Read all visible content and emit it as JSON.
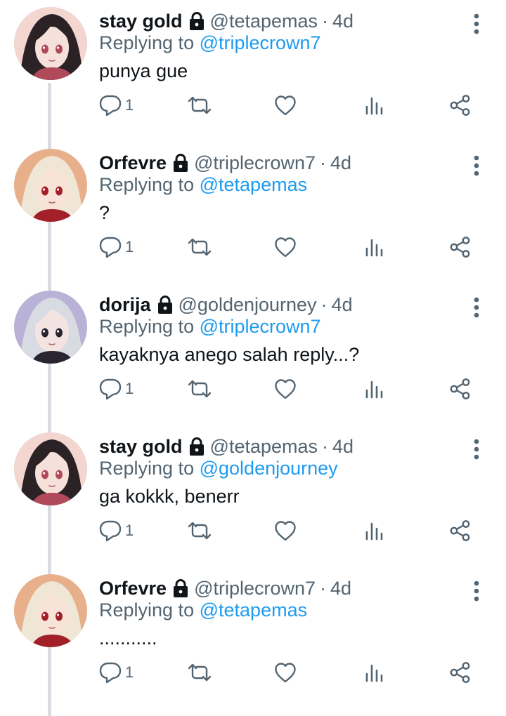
{
  "tweets": [
    {
      "display_name": "stay gold",
      "handle": "@tetapemas",
      "time": "4d",
      "replying_label": "Replying to",
      "replying_to": "@triplecrown7",
      "text": "punya gue",
      "reply_count": "1",
      "avatar_palette": {
        "bg": "#f3d6cf",
        "hair": "#2b2226",
        "skin": "#f6e1da",
        "accent": "#b04a5a"
      }
    },
    {
      "display_name": "Orfevre",
      "handle": "@triplecrown7",
      "time": "4d",
      "replying_label": "Replying to",
      "replying_to": "@tetapemas",
      "text": "?",
      "reply_count": "1",
      "avatar_palette": {
        "bg": "#e7b08a",
        "hair": "#efe6d5",
        "skin": "#f7e3d8",
        "accent": "#a3202a"
      }
    },
    {
      "display_name": "dorija",
      "handle": "@goldenjourney",
      "time": "4d",
      "replying_label": "Replying to",
      "replying_to": "@triplecrown7",
      "text": "kayaknya anego salah reply...?",
      "reply_count": "1",
      "avatar_palette": {
        "bg": "#b9b2d6",
        "hair": "#d9dbe3",
        "skin": "#f4e4e1",
        "accent": "#2a2431"
      }
    },
    {
      "display_name": "stay gold",
      "handle": "@tetapemas",
      "time": "4d",
      "replying_label": "Replying to",
      "replying_to": "@goldenjourney",
      "text": "ga kokkk, benerr",
      "reply_count": "1",
      "avatar_palette": {
        "bg": "#f3d6cf",
        "hair": "#2b2226",
        "skin": "#f6e1da",
        "accent": "#b04a5a"
      }
    },
    {
      "display_name": "Orfevre",
      "handle": "@triplecrown7",
      "time": "4d",
      "replying_label": "Replying to",
      "replying_to": "@tetapemas",
      "text": "...........",
      "reply_count": "1",
      "avatar_palette": {
        "bg": "#e7b08a",
        "hair": "#efe6d5",
        "skin": "#f7e3d8",
        "accent": "#a3202a"
      }
    }
  ],
  "icons": {
    "protected": "lock-icon",
    "more": "more-vertical-icon",
    "reply": "reply-icon",
    "retweet": "retweet-icon",
    "like": "heart-icon",
    "views": "analytics-icon",
    "share": "share-icon"
  },
  "colors": {
    "text": "#0f1419",
    "muted": "#536471",
    "mention": "#1d9bf0",
    "thread_line": "#d9dde1",
    "background": "#ffffff"
  }
}
